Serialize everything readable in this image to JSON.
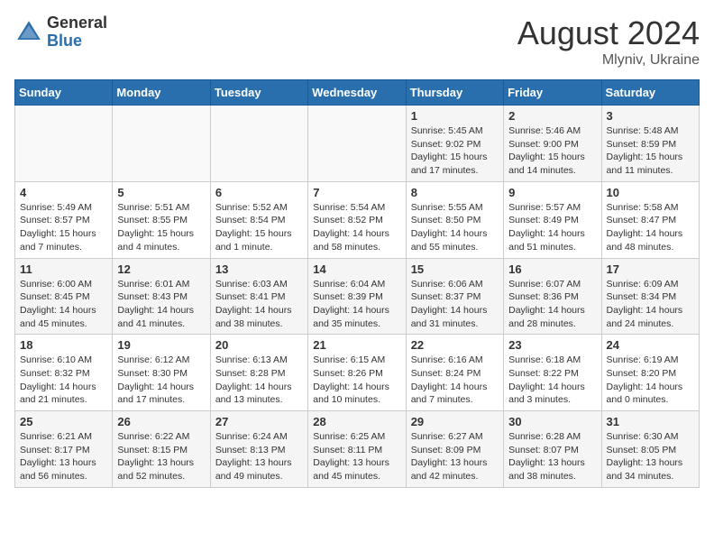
{
  "header": {
    "logo_general": "General",
    "logo_blue": "Blue",
    "month_title": "August 2024",
    "location": "Mlyniv, Ukraine"
  },
  "days_of_week": [
    "Sunday",
    "Monday",
    "Tuesday",
    "Wednesday",
    "Thursday",
    "Friday",
    "Saturday"
  ],
  "weeks": [
    [
      {
        "day": "",
        "info": ""
      },
      {
        "day": "",
        "info": ""
      },
      {
        "day": "",
        "info": ""
      },
      {
        "day": "",
        "info": ""
      },
      {
        "day": "1",
        "info": "Sunrise: 5:45 AM\nSunset: 9:02 PM\nDaylight: 15 hours and 17 minutes."
      },
      {
        "day": "2",
        "info": "Sunrise: 5:46 AM\nSunset: 9:00 PM\nDaylight: 15 hours and 14 minutes."
      },
      {
        "day": "3",
        "info": "Sunrise: 5:48 AM\nSunset: 8:59 PM\nDaylight: 15 hours and 11 minutes."
      }
    ],
    [
      {
        "day": "4",
        "info": "Sunrise: 5:49 AM\nSunset: 8:57 PM\nDaylight: 15 hours and 7 minutes."
      },
      {
        "day": "5",
        "info": "Sunrise: 5:51 AM\nSunset: 8:55 PM\nDaylight: 15 hours and 4 minutes."
      },
      {
        "day": "6",
        "info": "Sunrise: 5:52 AM\nSunset: 8:54 PM\nDaylight: 15 hours and 1 minute."
      },
      {
        "day": "7",
        "info": "Sunrise: 5:54 AM\nSunset: 8:52 PM\nDaylight: 14 hours and 58 minutes."
      },
      {
        "day": "8",
        "info": "Sunrise: 5:55 AM\nSunset: 8:50 PM\nDaylight: 14 hours and 55 minutes."
      },
      {
        "day": "9",
        "info": "Sunrise: 5:57 AM\nSunset: 8:49 PM\nDaylight: 14 hours and 51 minutes."
      },
      {
        "day": "10",
        "info": "Sunrise: 5:58 AM\nSunset: 8:47 PM\nDaylight: 14 hours and 48 minutes."
      }
    ],
    [
      {
        "day": "11",
        "info": "Sunrise: 6:00 AM\nSunset: 8:45 PM\nDaylight: 14 hours and 45 minutes."
      },
      {
        "day": "12",
        "info": "Sunrise: 6:01 AM\nSunset: 8:43 PM\nDaylight: 14 hours and 41 minutes."
      },
      {
        "day": "13",
        "info": "Sunrise: 6:03 AM\nSunset: 8:41 PM\nDaylight: 14 hours and 38 minutes."
      },
      {
        "day": "14",
        "info": "Sunrise: 6:04 AM\nSunset: 8:39 PM\nDaylight: 14 hours and 35 minutes."
      },
      {
        "day": "15",
        "info": "Sunrise: 6:06 AM\nSunset: 8:37 PM\nDaylight: 14 hours and 31 minutes."
      },
      {
        "day": "16",
        "info": "Sunrise: 6:07 AM\nSunset: 8:36 PM\nDaylight: 14 hours and 28 minutes."
      },
      {
        "day": "17",
        "info": "Sunrise: 6:09 AM\nSunset: 8:34 PM\nDaylight: 14 hours and 24 minutes."
      }
    ],
    [
      {
        "day": "18",
        "info": "Sunrise: 6:10 AM\nSunset: 8:32 PM\nDaylight: 14 hours and 21 minutes."
      },
      {
        "day": "19",
        "info": "Sunrise: 6:12 AM\nSunset: 8:30 PM\nDaylight: 14 hours and 17 minutes."
      },
      {
        "day": "20",
        "info": "Sunrise: 6:13 AM\nSunset: 8:28 PM\nDaylight: 14 hours and 13 minutes."
      },
      {
        "day": "21",
        "info": "Sunrise: 6:15 AM\nSunset: 8:26 PM\nDaylight: 14 hours and 10 minutes."
      },
      {
        "day": "22",
        "info": "Sunrise: 6:16 AM\nSunset: 8:24 PM\nDaylight: 14 hours and 7 minutes."
      },
      {
        "day": "23",
        "info": "Sunrise: 6:18 AM\nSunset: 8:22 PM\nDaylight: 14 hours and 3 minutes."
      },
      {
        "day": "24",
        "info": "Sunrise: 6:19 AM\nSunset: 8:20 PM\nDaylight: 14 hours and 0 minutes."
      }
    ],
    [
      {
        "day": "25",
        "info": "Sunrise: 6:21 AM\nSunset: 8:17 PM\nDaylight: 13 hours and 56 minutes."
      },
      {
        "day": "26",
        "info": "Sunrise: 6:22 AM\nSunset: 8:15 PM\nDaylight: 13 hours and 52 minutes."
      },
      {
        "day": "27",
        "info": "Sunrise: 6:24 AM\nSunset: 8:13 PM\nDaylight: 13 hours and 49 minutes."
      },
      {
        "day": "28",
        "info": "Sunrise: 6:25 AM\nSunset: 8:11 PM\nDaylight: 13 hours and 45 minutes."
      },
      {
        "day": "29",
        "info": "Sunrise: 6:27 AM\nSunset: 8:09 PM\nDaylight: 13 hours and 42 minutes."
      },
      {
        "day": "30",
        "info": "Sunrise: 6:28 AM\nSunset: 8:07 PM\nDaylight: 13 hours and 38 minutes."
      },
      {
        "day": "31",
        "info": "Sunrise: 6:30 AM\nSunset: 8:05 PM\nDaylight: 13 hours and 34 minutes."
      }
    ]
  ]
}
